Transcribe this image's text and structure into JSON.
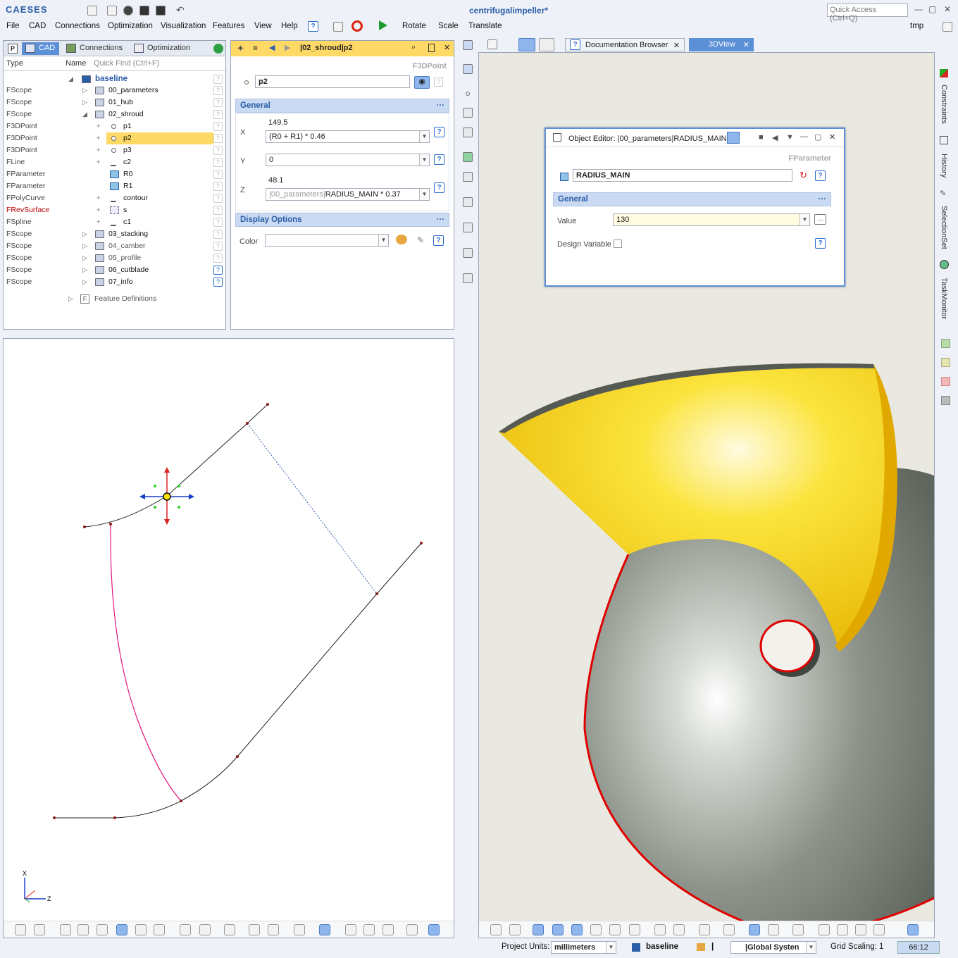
{
  "app": {
    "logo": "CAESES",
    "title": "centrifugalimpeller*",
    "quick_access_placeholder": "Quick Access (Ctrl+Q)",
    "menu": [
      "File",
      "CAD",
      "Connections",
      "Optimization",
      "Visualization",
      "Features",
      "View",
      "Help"
    ],
    "tools": [
      "Rotate",
      "Scale",
      "Translate"
    ],
    "workspace": "tmp"
  },
  "left_panel": {
    "tabs": [
      "CAD",
      "Connections",
      "Optimization"
    ],
    "col_type": "Type",
    "col_name": "Name",
    "quick_find": "Quick Find (Ctrl+F)",
    "root": "baseline",
    "rows": [
      {
        "type": "FScope",
        "name": "00_parameters"
      },
      {
        "type": "FScope",
        "name": "01_hub"
      },
      {
        "type": "FScope",
        "name": "02_shroud"
      },
      {
        "type": "F3DPoint",
        "name": "p1"
      },
      {
        "type": "F3DPoint",
        "name": "p2"
      },
      {
        "type": "F3DPoint",
        "name": "p3"
      },
      {
        "type": "FLine",
        "name": "c2"
      },
      {
        "type": "FParameter",
        "name": "R0"
      },
      {
        "type": "FParameter",
        "name": "R1"
      },
      {
        "type": "FPolyCurve",
        "name": "contour"
      },
      {
        "type": "FRevSurface",
        "name": "s"
      },
      {
        "type": "FSpline",
        "name": "c1"
      },
      {
        "type": "FScope",
        "name": "03_stacking"
      },
      {
        "type": "FScope",
        "name": "04_camber"
      },
      {
        "type": "FScope",
        "name": "05_profile"
      },
      {
        "type": "FScope",
        "name": "06_cutblade"
      },
      {
        "type": "FScope",
        "name": "07_info"
      }
    ],
    "feature_definitions": "Feature Definitions"
  },
  "object_panel": {
    "path": "|02_shroud|p2",
    "class": "F3DPoint",
    "name": "p2",
    "section_general": "General",
    "x_label": "X",
    "x_value": "149.5",
    "x_expr": "(R0 + R1) * 0.46",
    "y_label": "Y",
    "y_expr": "0",
    "z_label": "Z",
    "z_value": "48.1",
    "z_expr_prefix": "|00_parameters|",
    "z_expr": "RADIUS_MAIN * 0.37",
    "section_display": "Display Options",
    "color_label": "Color"
  },
  "view_tabs": [
    "Documentation Browser",
    "3DView"
  ],
  "object_editor": {
    "title": "Object Editor: |00_parameters|RADIUS_MAIN",
    "class": "FParameter",
    "name": "RADIUS_MAIN",
    "section": "General",
    "value_label": "Value",
    "value": "130",
    "design_variable_label": "Design Variable"
  },
  "right_side_tabs": [
    "Constraints",
    "History",
    "SelectionSet",
    "TaskMonitor"
  ],
  "status_bar": {
    "units_label": "Project Units:",
    "units": "millimeters",
    "design": "baseline",
    "separator": "|",
    "coord_system": "|Global Systen",
    "grid_label": "Grid Scaling: 1",
    "counter": "66:12"
  },
  "axis": {
    "x": "X",
    "z": "Z"
  },
  "colors": {
    "accent": "#5b8fd6",
    "section": "#c9daf2",
    "selected": "#ffd966",
    "surface_yellow": "#f3d21d",
    "surface_grey": "#7f877d",
    "curve_pink": "#e0177e"
  }
}
